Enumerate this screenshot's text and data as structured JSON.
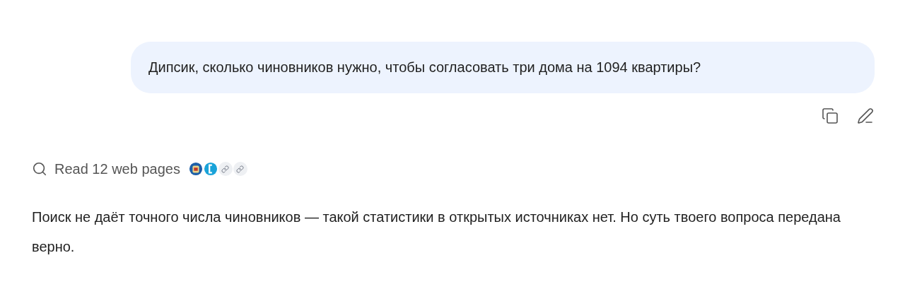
{
  "user_message": {
    "text": "Дипсик, сколько чиновников нужно, чтобы согласовать три дома на 1094 квартиры?"
  },
  "search_summary": {
    "label": "Read 12 web pages",
    "sources": [
      {
        "kind": "emblem"
      },
      {
        "kind": "bracket"
      },
      {
        "kind": "link"
      },
      {
        "kind": "link"
      }
    ]
  },
  "answer": {
    "text": "Поиск не даёт точного числа чиновников — такой статистики в открытых источниках нет. Но суть твоего вопроса передана верно."
  }
}
